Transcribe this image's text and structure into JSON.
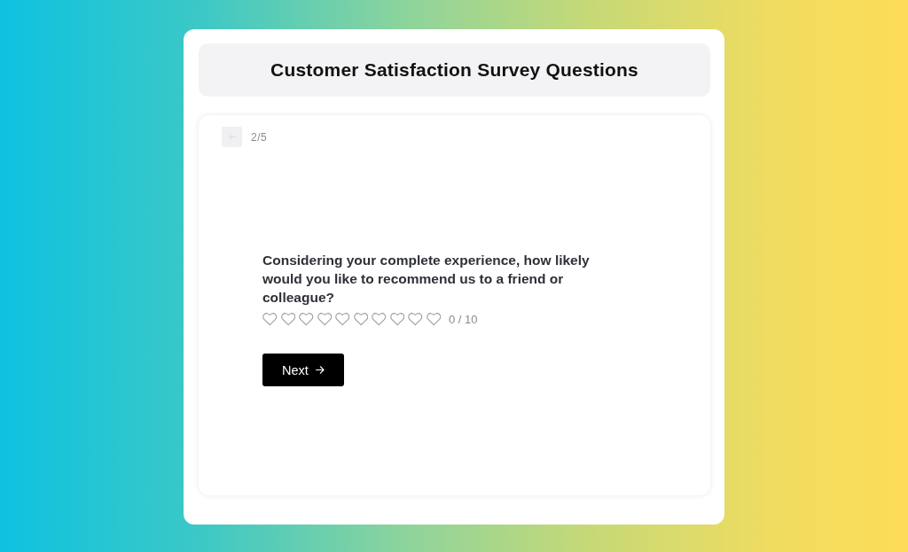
{
  "header": {
    "title": "Customer Satisfaction Survey Questions"
  },
  "survey": {
    "back_button": {
      "disabled": true
    },
    "progress": "2/5",
    "question": "Considering your complete experience, how likely would you like to recommend us to a friend or colleague?",
    "rating": {
      "stars": 0,
      "reading": "0 / 10"
    },
    "next_button": {
      "label": "Next"
    }
  }
}
